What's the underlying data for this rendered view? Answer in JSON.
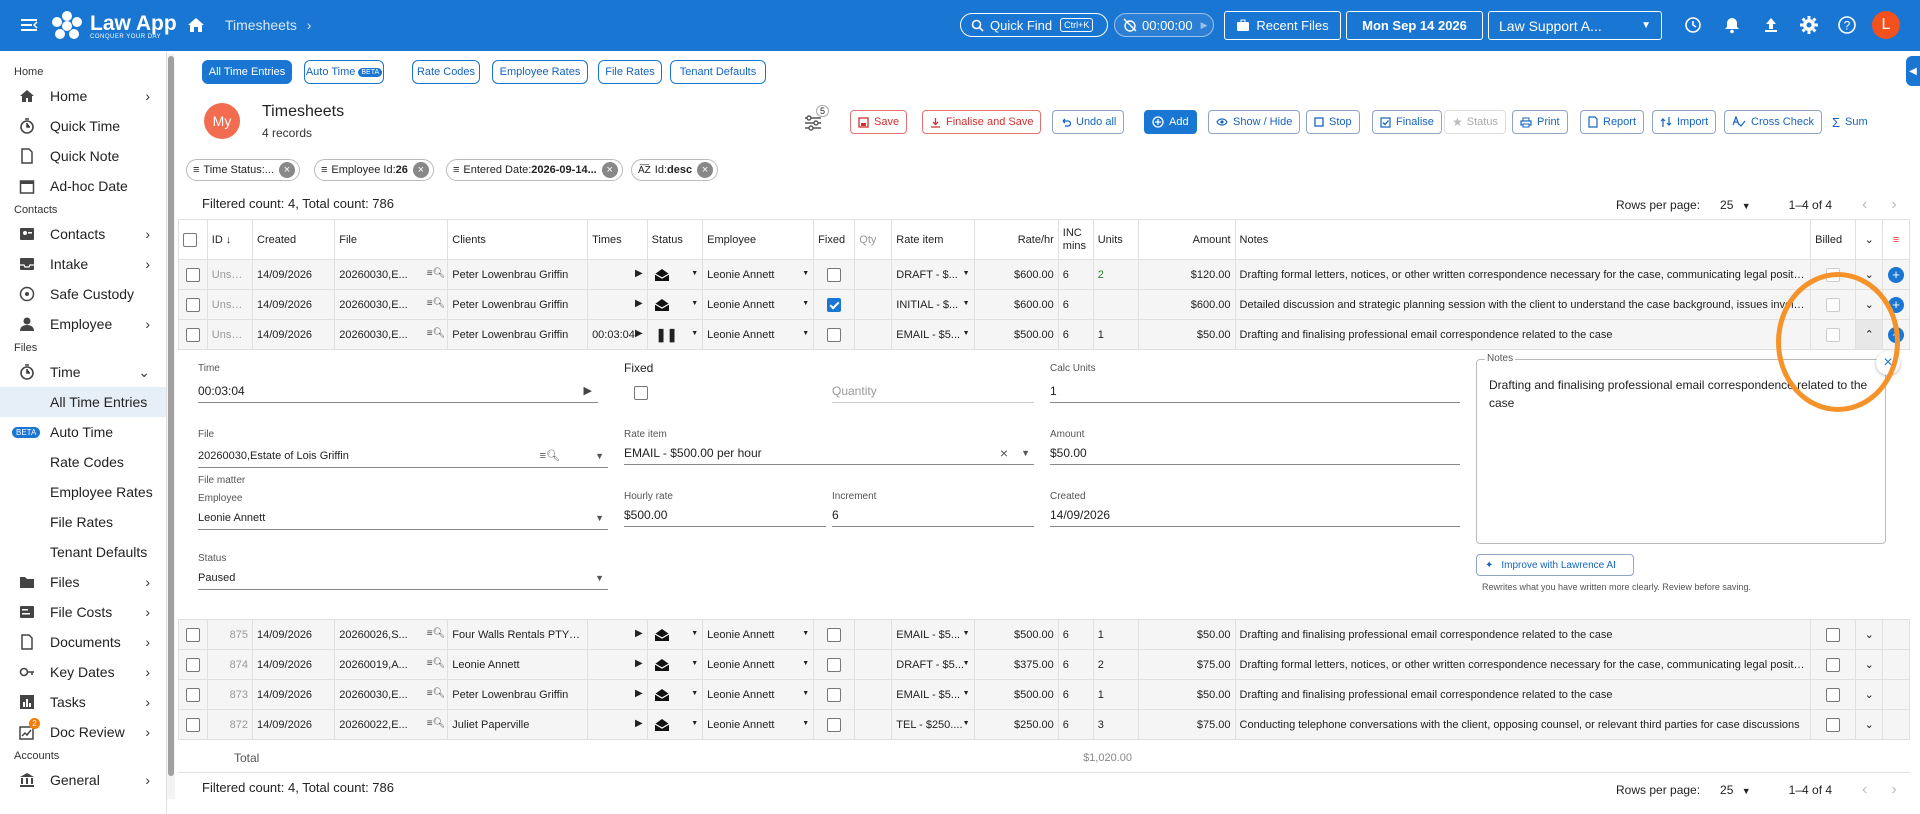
{
  "app": {
    "name": "Law App",
    "tagline": "CONQUER YOUR DAY",
    "breadcrumb": "Timesheets"
  },
  "topbar": {
    "quick_find": "Quick Find",
    "shortcut": "Ctrl+K",
    "timer": "00:00:00",
    "recent_files": "Recent Files",
    "date": "Mon Sep 14 2026",
    "tenant": "Law Support A...",
    "avatar": "L"
  },
  "sidebar": {
    "sections": [
      "Home",
      "Contacts",
      "Files",
      "Accounts"
    ],
    "home_items": [
      "Home",
      "Quick Time",
      "Quick Note",
      "Ad-hoc Date"
    ],
    "contact_items": [
      "Contacts",
      "Intake",
      "Safe Custody",
      "Employee"
    ],
    "time": "Time",
    "time_sub": [
      "All Time Entries",
      "Auto Time",
      "Rate Codes",
      "Employee Rates",
      "File Rates",
      "Tenant Defaults"
    ],
    "beta": "BETA",
    "file_items": [
      "Files",
      "File Costs",
      "Documents",
      "Key Dates",
      "Tasks",
      "Doc Review"
    ],
    "doc_review_badge": "2",
    "account_items": [
      "General"
    ]
  },
  "tabs": [
    {
      "label": "All Time Entries"
    },
    {
      "label": "Auto Time"
    },
    {
      "label": "Rate Codes"
    },
    {
      "label": "Employee Rates"
    },
    {
      "label": "File Rates"
    },
    {
      "label": "Tenant Defaults"
    }
  ],
  "auto_time_badge": "BETA",
  "page": {
    "avatar": "My",
    "title": "Timesheets",
    "records": "4 records",
    "filter_badge": "5"
  },
  "actions": {
    "save": "Save",
    "finalise_save": "Finalise and Save",
    "undo": "Undo all",
    "add": "Add",
    "show_hide": "Show / Hide",
    "stop": "Stop",
    "finalise": "Finalise",
    "status": "Status",
    "print": "Print",
    "report": "Report",
    "import": "Import",
    "cross_check": "Cross Check",
    "sum": "Sum"
  },
  "filters": [
    {
      "label": "Time Status:..."
    },
    {
      "label": "Employee Id:",
      "value": "26"
    },
    {
      "label": "Entered Date:",
      "value": "2026-09-14..."
    },
    {
      "label": "Id:",
      "value": "desc"
    }
  ],
  "counts": {
    "text": "Filtered count: 4, Total count: 786",
    "rows_per_page_label": "Rows per page:",
    "rows_per_page": "25",
    "range": "1–4 of 4"
  },
  "columns": {
    "id": "ID",
    "created": "Created",
    "file": "File",
    "clients": "Clients",
    "times": "Times",
    "status": "Status",
    "employee": "Employee",
    "fixed": "Fixed",
    "qty": "Qty",
    "rate_item": "Rate item",
    "rate": "Rate/hr",
    "inc1": "INC",
    "inc2": "mins",
    "units": "Units",
    "amount": "Amount",
    "notes": "Notes",
    "billed": "Billed"
  },
  "rows_top": [
    {
      "id": "Unsaved",
      "created": "14/09/2026",
      "file": "20260030,E...",
      "client": "Peter Lowenbrau Griffin",
      "time": "",
      "employee": "Leonie Annett",
      "fixed": false,
      "rate_item": "DRAFT - $...",
      "rate": "$600.00",
      "inc": "6",
      "units": "2",
      "amount": "$120.00",
      "notes": "Drafting formal letters, notices, or other written correspondence necessary for the case, communicating legal positions"
    },
    {
      "id": "Unsaved",
      "created": "14/09/2026",
      "file": "20260030,E...",
      "client": "Peter Lowenbrau Griffin",
      "time": "",
      "employee": "Leonie Annett",
      "fixed": true,
      "rate_item": "INITIAL - $...",
      "rate": "$600.00",
      "inc": "6",
      "units": "",
      "amount": "$600.00",
      "notes": "Detailed discussion and strategic planning session with the client to understand the case background, issues involved"
    },
    {
      "id": "Unsaved",
      "created": "14/09/2026",
      "file": "20260030,E...",
      "client": "Peter Lowenbrau Griffin",
      "time": "00:03:04",
      "employee": "Leonie Annett",
      "fixed": false,
      "rate_item": "EMAIL - $5...",
      "rate": "$500.00",
      "inc": "6",
      "units": "1",
      "amount": "$50.00",
      "notes": "Drafting and finalising professional email correspondence related to the case"
    }
  ],
  "detail": {
    "time_label": "Time",
    "time": "00:03:04",
    "fixed_label": "Fixed",
    "quantity_placeholder": "Quantity",
    "calc_units_label": "Calc Units",
    "calc_units": "1",
    "notes_label": "Notes",
    "notes": "Drafting and finalising professional email correspondence related to the case",
    "file_label": "File",
    "file": "20260030,Estate of Lois Griffin",
    "file_helper": "File matter",
    "rate_item_label": "Rate item",
    "rate_item": "EMAIL - $500.00 per hour",
    "amount_label": "Amount",
    "amount": "$50.00",
    "employee_label": "Employee",
    "employee": "Leonie Annett",
    "hourly_label": "Hourly rate",
    "hourly": "$500.00",
    "increment_label": "Increment",
    "increment": "6",
    "created_label": "Created",
    "created": "14/09/2026",
    "status_label": "Status",
    "status": "Paused",
    "improve": "Improve with Lawrence AI",
    "improve_hint": "Rewrites what you have written more clearly. Review before saving."
  },
  "rows_bottom": [
    {
      "id": "875",
      "created": "14/09/2026",
      "file": "20260026,S...",
      "client": "Four Walls Rentals PTY L...",
      "employee": "Leonie Annett",
      "rate_item": "EMAIL - $5...",
      "rate": "$500.00",
      "inc": "6",
      "units": "1",
      "amount": "$50.00",
      "notes": "Drafting and finalising professional email correspondence related to the case"
    },
    {
      "id": "874",
      "created": "14/09/2026",
      "file": "20260019,A...",
      "client": "Leonie Annett",
      "employee": "Leonie Annett",
      "rate_item": "DRAFT - $5...",
      "rate": "$375.00",
      "inc": "6",
      "units": "2",
      "amount": "$75.00",
      "notes": "Drafting formal letters, notices, or other written correspondence necessary for the case, communicating legal positions"
    },
    {
      "id": "873",
      "created": "14/09/2026",
      "file": "20260030,E...",
      "client": "Peter Lowenbrau Griffin",
      "employee": "Leonie Annett",
      "rate_item": "EMAIL - $5...",
      "rate": "$500.00",
      "inc": "6",
      "units": "1",
      "amount": "$50.00",
      "notes": "Drafting and finalising professional email correspondence related to the case"
    },
    {
      "id": "872",
      "created": "14/09/2026",
      "file": "20260022,E...",
      "client": "Juliet Paperville",
      "employee": "Leonie Annett",
      "rate_item": "TEL - $250....",
      "rate": "$250.00",
      "inc": "6",
      "units": "3",
      "amount": "$75.00",
      "notes": "Conducting telephone conversations with the client, opposing counsel, or relevant third parties for case discussions"
    }
  ],
  "total": {
    "label": "Total",
    "amount": "$1,020.00"
  }
}
